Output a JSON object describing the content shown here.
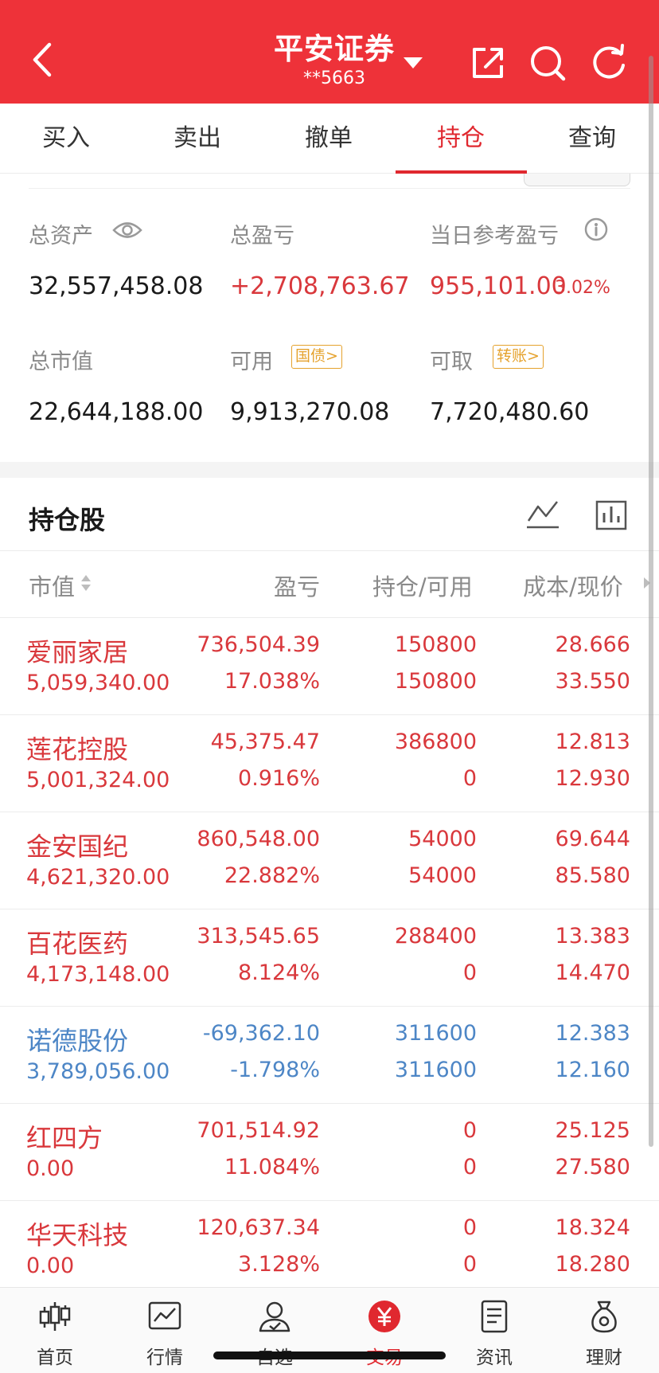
{
  "header": {
    "title": "平安证券",
    "account": "**5663"
  },
  "tabs": [
    {
      "label": "买入"
    },
    {
      "label": "卖出"
    },
    {
      "label": "撤单"
    },
    {
      "label": "持仓"
    },
    {
      "label": "查询"
    }
  ],
  "active_tab": "持仓",
  "summary": {
    "total_assets_label": "总资产",
    "total_assets_value": "32,557,458.08",
    "total_pnl_label": "总盈亏",
    "total_pnl_value": "+2,708,763.67",
    "daily_pnl_label": "当日参考盈亏",
    "daily_pnl_value": "955,101.00",
    "daily_pnl_pct": "3.02%",
    "market_value_label": "总市值",
    "market_value_value": "22,644,188.00",
    "available_label": "可用",
    "available_tag": "国债>",
    "available_value": "9,913,270.08",
    "withdrawable_label": "可取",
    "withdrawable_tag": "转账>",
    "withdrawable_value": "7,720,480.60"
  },
  "holdings": {
    "title": "持仓股",
    "columns": {
      "market_value": "市值",
      "pnl": "盈亏",
      "position": "持仓/可用",
      "cost_price": "成本/现价"
    },
    "rows": [
      {
        "name": "爱丽家居",
        "market_value": "5,059,340.00",
        "pnl": "736,504.39",
        "pnl_pct": "17.038%",
        "position": "150800",
        "available": "150800",
        "cost": "28.666",
        "price": "33.550",
        "color": "red"
      },
      {
        "name": "莲花控股",
        "market_value": "5,001,324.00",
        "pnl": "45,375.47",
        "pnl_pct": "0.916%",
        "position": "386800",
        "available": "0",
        "cost": "12.813",
        "price": "12.930",
        "color": "red"
      },
      {
        "name": "金安国纪",
        "market_value": "4,621,320.00",
        "pnl": "860,548.00",
        "pnl_pct": "22.882%",
        "position": "54000",
        "available": "54000",
        "cost": "69.644",
        "price": "85.580",
        "color": "red"
      },
      {
        "name": "百花医药",
        "market_value": "4,173,148.00",
        "pnl": "313,545.65",
        "pnl_pct": "8.124%",
        "position": "288400",
        "available": "0",
        "cost": "13.383",
        "price": "14.470",
        "color": "red"
      },
      {
        "name": "诺德股份",
        "market_value": "3,789,056.00",
        "pnl": "-69,362.10",
        "pnl_pct": "-1.798%",
        "position": "311600",
        "available": "311600",
        "cost": "12.383",
        "price": "12.160",
        "color": "blue"
      },
      {
        "name": "红四方",
        "market_value": "0.00",
        "pnl": "701,514.92",
        "pnl_pct": "11.084%",
        "position": "0",
        "available": "0",
        "cost": "25.125",
        "price": "27.580",
        "color": "red"
      },
      {
        "name": "华天科技",
        "market_value": "0.00",
        "pnl": "120,637.34",
        "pnl_pct": "3.128%",
        "position": "0",
        "available": "0",
        "cost": "18.324",
        "price": "18.280",
        "color": "red"
      }
    ]
  },
  "bottom_nav": [
    {
      "label": "首页",
      "icon": "candlestick-icon"
    },
    {
      "label": "行情",
      "icon": "chart-icon"
    },
    {
      "label": "自选",
      "icon": "user-icon"
    },
    {
      "label": "交易",
      "icon": "yuan-icon"
    },
    {
      "label": "资讯",
      "icon": "document-icon"
    },
    {
      "label": "理财",
      "icon": "money-bag-icon"
    }
  ],
  "colors": {
    "brand_red": "#ee3239",
    "profit_red": "#d9383c",
    "loss_blue": "#4d86c6",
    "tag_orange": "#e5a22d"
  }
}
